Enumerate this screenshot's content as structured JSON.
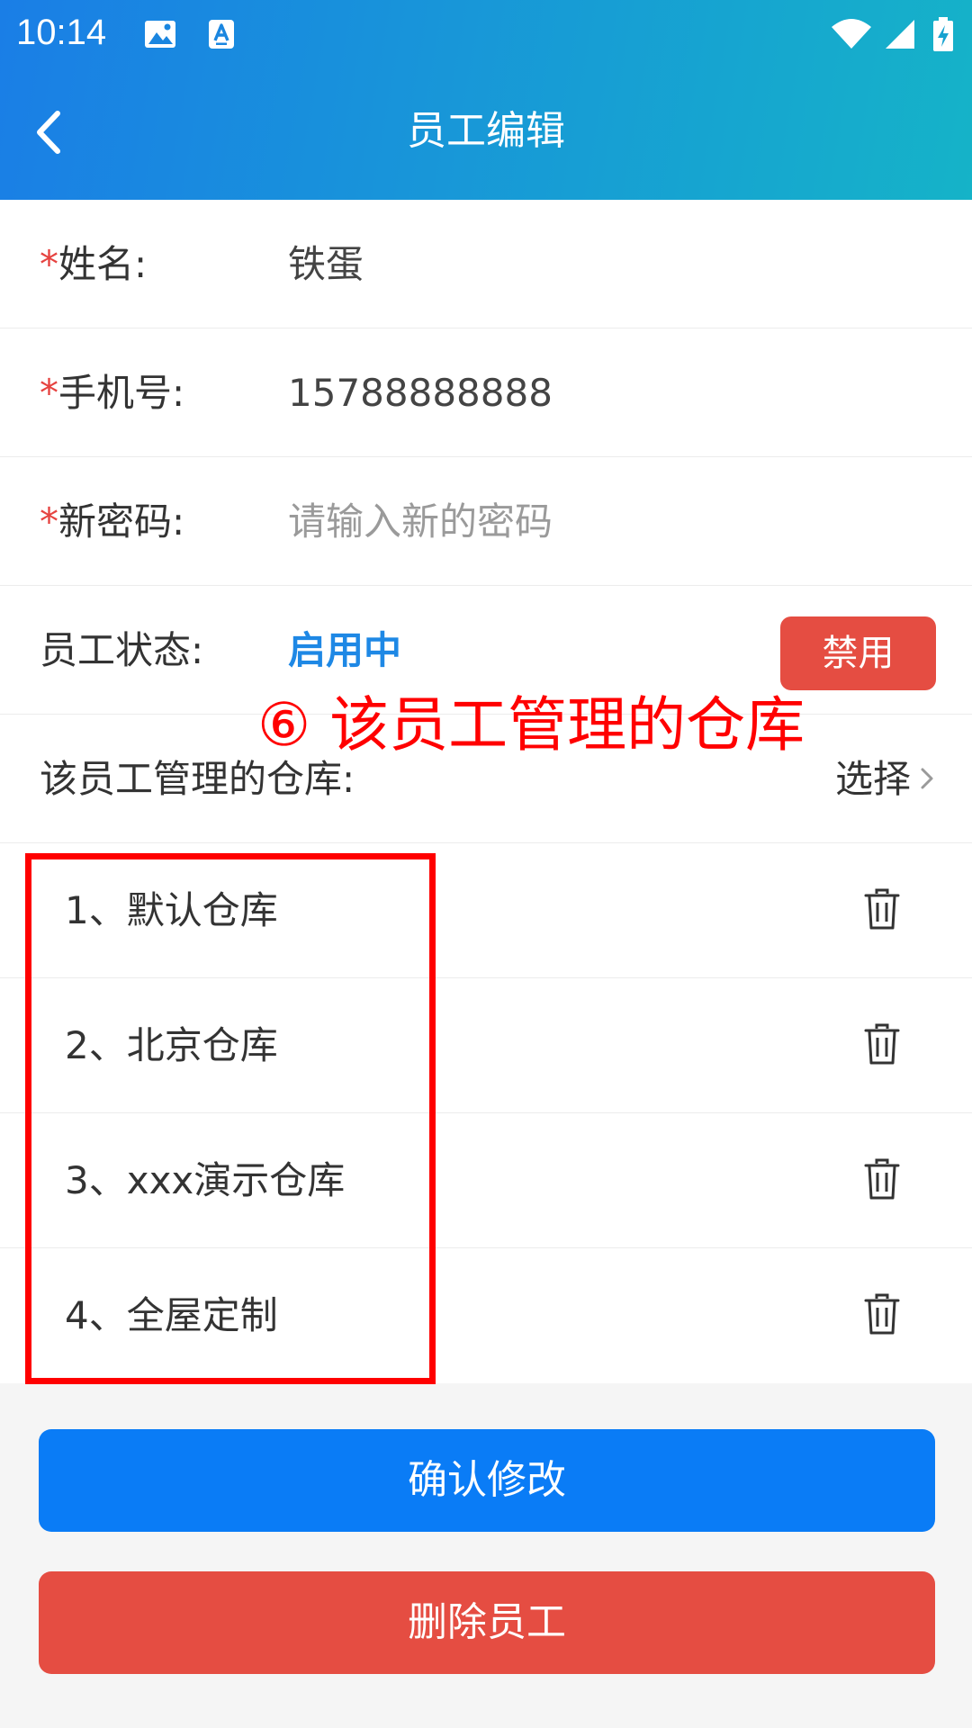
{
  "status_bar": {
    "time": "10:14",
    "left_icons": [
      "image-icon",
      "font-badge-icon"
    ],
    "right_icons": [
      "wifi-icon",
      "cellular-signal-icon",
      "battery-charging-icon"
    ]
  },
  "header": {
    "title": "员工编辑",
    "back_icon": "chevron-left-icon",
    "gradient": [
      "#1a7ee6",
      "#15b3c8"
    ]
  },
  "form": {
    "required_mark": "*",
    "name": {
      "label": "姓名:",
      "value": "铁蛋"
    },
    "phone": {
      "label": "手机号:",
      "value": "15788888888"
    },
    "password": {
      "label": "新密码:",
      "placeholder": "请输入新的密码",
      "value": ""
    },
    "status": {
      "label": "员工状态:",
      "value": "启用中",
      "button": "禁用"
    },
    "warehouses": {
      "label": "该员工管理的仓库:",
      "select_label": "选择"
    }
  },
  "warehouse_list": [
    {
      "label": "1、默认仓库"
    },
    {
      "label": "2、北京仓库"
    },
    {
      "label": "3、xxx演示仓库"
    },
    {
      "label": "4、全屋定制"
    }
  ],
  "annotation": {
    "text": "⑥ 该员工管理的仓库",
    "color": "#ff0000"
  },
  "buttons": {
    "confirm": "确认修改",
    "delete": "删除员工"
  },
  "colors": {
    "primary": "#0a7cf6",
    "danger": "#e54d42",
    "status_active": "#1e88e5",
    "required": "#e64340"
  }
}
